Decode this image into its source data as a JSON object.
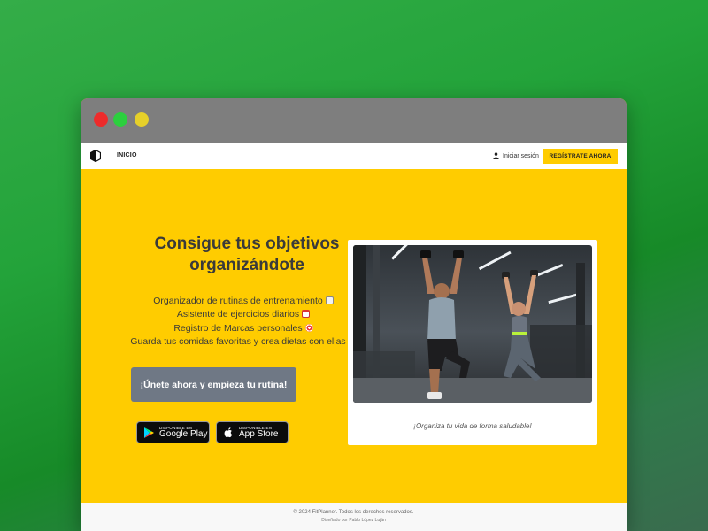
{
  "window": {
    "controls": [
      "close",
      "minimize",
      "maximize"
    ]
  },
  "navbar": {
    "logo_icon": "half-circle-logo-icon",
    "home_label": "INICIO",
    "login_icon": "user-icon",
    "login_label": "Iniciar sesión",
    "register_label": "REGÍSTRATE AHORA"
  },
  "hero": {
    "headline_line1": "Consigue tus objetivos",
    "headline_line2": "organizándote",
    "features": [
      {
        "text": "Organizador de rutinas de entrenamiento",
        "icon": "clipboard-icon"
      },
      {
        "text": "Asistente de ejercicios diarios",
        "icon": "calendar-icon"
      },
      {
        "text": "Registro de Marcas personales",
        "icon": "target-icon"
      },
      {
        "text": "Guarda tus comidas favoritas y crea dietas con ellas",
        "icon": "laptop-icon"
      }
    ],
    "cta_label": "¡Únete ahora y empieza tu rutina!",
    "google_play": {
      "small": "DISPONIBLE EN",
      "big": "Google Play"
    },
    "app_store": {
      "small": "DISPONIBLE EN",
      "big": "App Store"
    },
    "image_caption": "¡Organiza tu vida de forma saludable!"
  },
  "footer": {
    "copyright": "© 2024 FitPlanner. Todos los derechos reservados.",
    "designer": "Diseñado por Pablo López Luján"
  },
  "colors": {
    "accent": "#ffcc00",
    "cta": "#6f7885",
    "titlebar": "#7e7e7e"
  }
}
